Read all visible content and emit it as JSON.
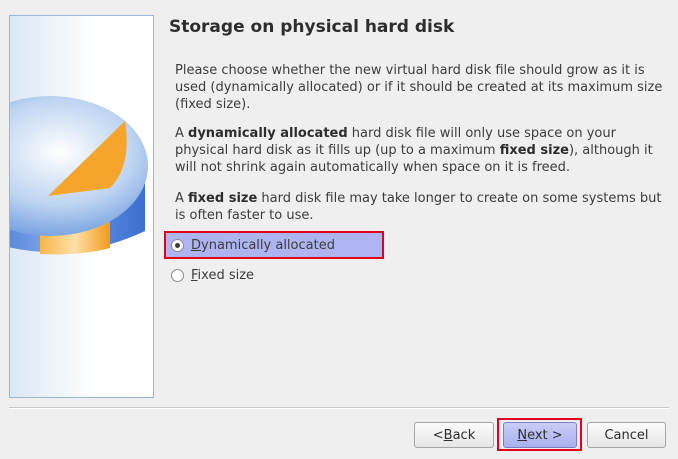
{
  "wizard": {
    "title": "Storage on physical hard disk",
    "paragraph1": "Please choose whether the new virtual hard disk file should grow as it is used (dynamically allocated) or if it should be created at its maximum size (fixed size).",
    "paragraph2": {
      "pre": "A ",
      "bold1": "dynamically allocated",
      "mid": " hard disk file will only use space on your physical hard disk as it fills up (up to a maximum ",
      "bold2": "fixed size",
      "post": "), although it will not shrink again automatically when space on it is freed."
    },
    "paragraph3": {
      "pre": "A ",
      "bold1": "fixed size",
      "post": " hard disk file may take longer to create on some systems but is often faster to use."
    },
    "options": [
      {
        "mnemonic": "D",
        "rest": "ynamically allocated",
        "selected": true
      },
      {
        "mnemonic": "F",
        "rest": "ixed size",
        "selected": false
      }
    ]
  },
  "buttons": {
    "back": {
      "pre": "< ",
      "mnemonic": "B",
      "rest": "ack"
    },
    "next": {
      "mnemonic": "N",
      "rest": "ext >"
    },
    "cancel": "Cancel"
  },
  "colors": {
    "selection": "#aeb4f0",
    "highlight_outline": "#e3001b",
    "disk_blue": "#3f78d6",
    "disk_orange": "#f5a623"
  },
  "icons": {
    "side_graphic": "hard-disk-pie-icon"
  }
}
